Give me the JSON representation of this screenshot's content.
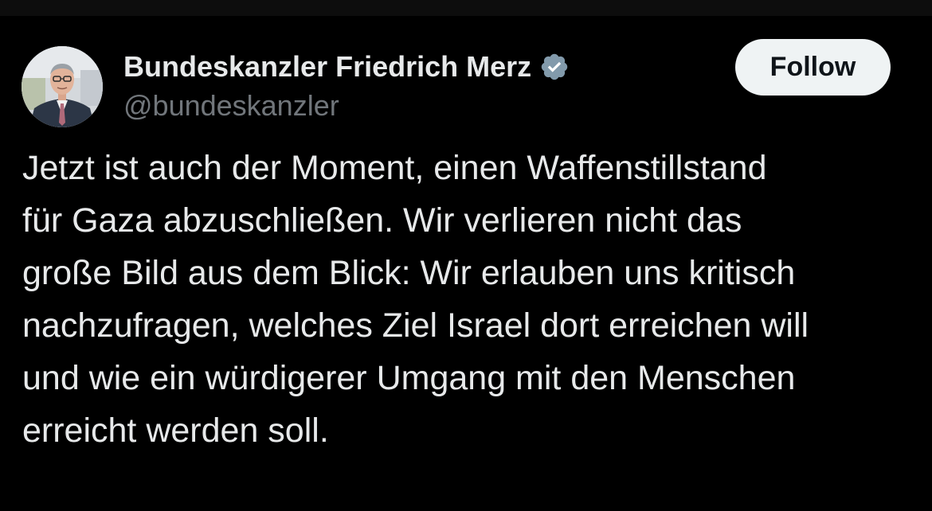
{
  "tweet": {
    "author": {
      "display_name": "Bundeskanzler Friedrich Merz",
      "handle": "@bundeskanzler",
      "verified": true,
      "verified_badge_color": "#829aab"
    },
    "follow_label": "Follow",
    "text_lines": [
      "Jetzt ist auch der Moment, einen Waffenstillstand",
      "für Gaza abzuschließen. Wir verlieren nicht das",
      "große Bild aus dem Blick: Wir erlauben uns kritisch",
      "nachzufragen, welches Ziel Israel dort erreichen will",
      "und wie ein würdigerer Umgang mit den Menschen",
      "erreicht werden soll."
    ]
  },
  "colors": {
    "background": "#000000",
    "text_primary": "#e7e9ea",
    "text_secondary": "#71767b",
    "button_bg": "#eff3f4",
    "button_text": "#0f1419"
  }
}
